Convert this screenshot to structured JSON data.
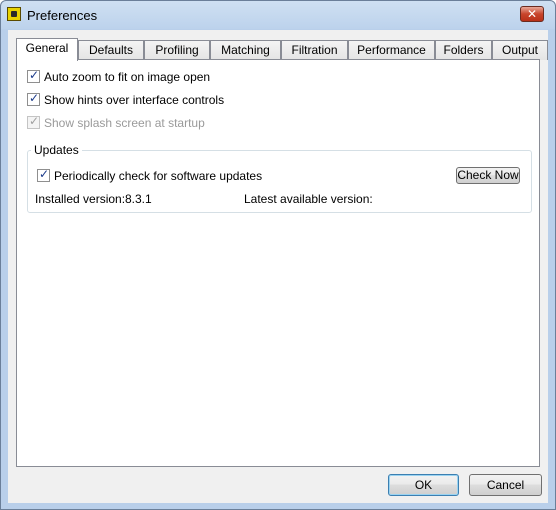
{
  "window": {
    "title": "Preferences",
    "close_label": "✕"
  },
  "tabs": [
    {
      "label": "General",
      "active": true
    },
    {
      "label": "Defaults"
    },
    {
      "label": "Profiling"
    },
    {
      "label": "Matching"
    },
    {
      "label": "Filtration"
    },
    {
      "label": "Performance"
    },
    {
      "label": "Folders"
    },
    {
      "label": "Output"
    }
  ],
  "general": {
    "auto_zoom": {
      "label": "Auto zoom to fit on image open",
      "checked": true
    },
    "show_hints": {
      "label": "Show hints over interface controls",
      "checked": true
    },
    "splash": {
      "label": "Show splash screen at startup",
      "checked": true,
      "disabled": true
    }
  },
  "updates": {
    "group_label": "Updates",
    "periodic_check": {
      "label": "Periodically check for software updates",
      "checked": true
    },
    "check_now_label": "Check Now",
    "installed_label": "Installed version:",
    "installed_value": "8.3.1",
    "latest_label": "Latest available version:",
    "latest_value": ""
  },
  "buttons": {
    "ok_label": "OK",
    "cancel_label": "Cancel"
  }
}
